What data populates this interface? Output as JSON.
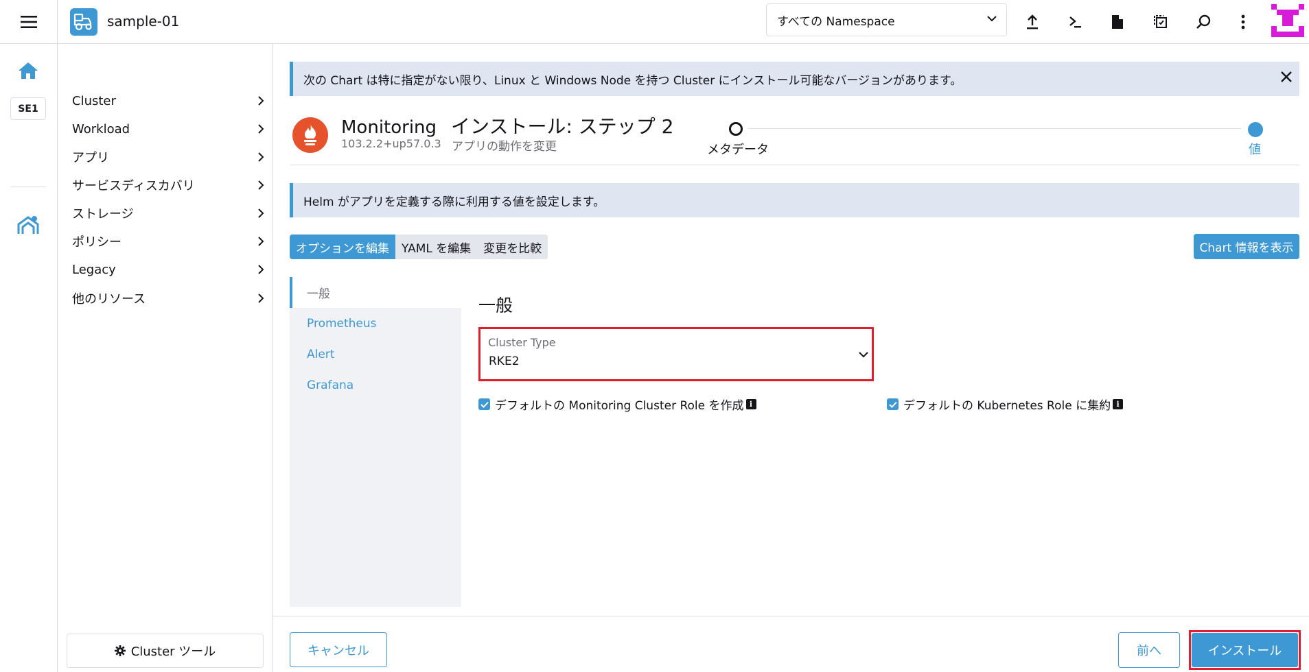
{
  "header": {
    "cluster_name": "sample-01",
    "namespace_filter": "すべての Namespace"
  },
  "rail": {
    "cluster_badge": "SE1"
  },
  "sidenav": {
    "items": [
      {
        "label": "Cluster"
      },
      {
        "label": "Workload"
      },
      {
        "label": "アプリ"
      },
      {
        "label": "サービスディスカバリ"
      },
      {
        "label": "ストレージ"
      },
      {
        "label": "ポリシー"
      },
      {
        "label": "Legacy"
      },
      {
        "label": "他のリソース"
      }
    ],
    "cluster_tools": "Cluster ツール"
  },
  "banner": {
    "text": "次の Chart は特に指定がない限り、Linux と Windows Node を持つ Cluster にインストール可能なバージョンがあります。"
  },
  "chart": {
    "name": "Monitoring",
    "version": "103.2.2+up57.0.3",
    "step_title": "インストール: ステップ 2",
    "step_subtitle": "アプリの動作を変更"
  },
  "wizard": {
    "steps": [
      {
        "label": "メタデータ",
        "status": "done"
      },
      {
        "label": "値",
        "status": "current"
      }
    ]
  },
  "info": {
    "text": "Helm がアプリを定義する際に利用する値を設定します。"
  },
  "tabs": [
    {
      "label": "オプションを編集",
      "active": true
    },
    {
      "label": "YAML を編集",
      "active": false
    },
    {
      "label": "変更を比較",
      "active": false
    }
  ],
  "chart_info_button": "Chart 情報を表示",
  "vtabs": [
    {
      "label": "一般",
      "active": true
    },
    {
      "label": "Prometheus",
      "active": false
    },
    {
      "label": "Alert",
      "active": false
    },
    {
      "label": "Grafana",
      "active": false
    }
  ],
  "form": {
    "section_title": "一般",
    "cluster_type": {
      "label": "Cluster Type",
      "value": "RKE2"
    },
    "checkboxes": [
      {
        "label": "デフォルトの Monitoring Cluster Role を作成",
        "checked": true
      },
      {
        "label": "デフォルトの Kubernetes Role に集約",
        "checked": true
      }
    ]
  },
  "footer": {
    "cancel": "キャンセル",
    "prev": "前へ",
    "install": "インストール"
  },
  "colors": {
    "accent": "#3d98d3",
    "highlight": "#e11d2c",
    "brand_avatar": "#d81bd8",
    "prometheus": "#e6522c"
  }
}
